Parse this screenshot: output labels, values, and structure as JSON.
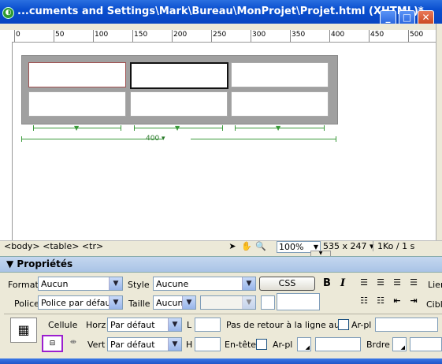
{
  "window": {
    "title": "...cuments and Settings\\Mark\\Bureau\\MonProjet\\Projet.html (XHTML)*",
    "app_icon": "dreamweaver-icon",
    "controls": {
      "minimize": "_",
      "maximize": "□",
      "close": "✕"
    }
  },
  "ruler": {
    "labels": [
      "0",
      "50",
      "100",
      "150",
      "200",
      "250",
      "300",
      "350",
      "400",
      "450",
      "500"
    ]
  },
  "table_guides": {
    "total_width_label": "400"
  },
  "statusbar": {
    "tag_selector": "<body> <table> <tr>",
    "zoom": "100%",
    "dimensions": "535 x 247",
    "filesize": "1Ko / 1 s"
  },
  "properties": {
    "title": "Propriétés",
    "format_label": "Format",
    "format_value": "Aucun",
    "style_label": "Style",
    "style_value": "Aucune",
    "css_button": "CSS",
    "bold": "B",
    "italic": "I",
    "link_label": "Lier",
    "font_label": "Police",
    "font_value": "Police par défaut",
    "size_label": "Taille",
    "size_value": "Aucun",
    "target_label": "Cible",
    "cell_label": "Cellule",
    "horz_label": "Horz",
    "horz_value": "Par défaut",
    "vert_label": "Vert",
    "vert_value": "Par défaut",
    "w_label": "L",
    "h_label": "H",
    "nowrap_label": "Pas de retour à la ligne auto",
    "header_label": "En-tête",
    "bg_label": "Ar-pl",
    "bg_label2": "Ar-pl",
    "border_label": "Brdre"
  },
  "colors": {
    "titlebar": "#0a4fcf",
    "panel": "#ece9d8",
    "guide_green": "#3a9a3a",
    "highlight": "#9b1fcf"
  }
}
